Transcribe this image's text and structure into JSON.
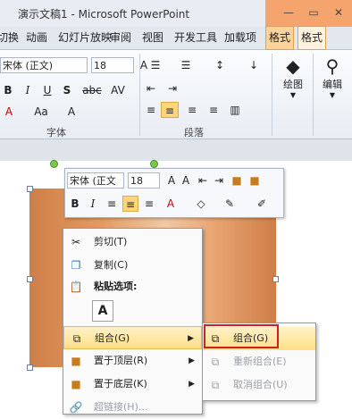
{
  "window": {
    "title": "演示文稿1 - Microsoft PowerPoint",
    "controls": [
      "—",
      "▭",
      "✕"
    ],
    "picture_tools_color": "#f4a46c"
  },
  "tabs": [
    "切换",
    "动画",
    "幻灯片放映",
    "审阅",
    "视图",
    "开发工具",
    "加载项",
    "格式",
    "格式"
  ],
  "ribbon": {
    "font_name": "宋体 (正文)",
    "font_size": "18",
    "font_group_label": "字体",
    "paragraph_group_label": "段落",
    "drawing_label": "绘图",
    "editing_label": "编辑",
    "bold": "B",
    "italic": "I",
    "underline": "U",
    "shadow": "S",
    "strike": "abc",
    "spacing": "AV",
    "font_color": "A",
    "case": "Aa",
    "clear": "A",
    "grow": "A",
    "shrink": "A"
  },
  "mini_toolbar": {
    "font_name": "宋体 (正文",
    "font_size": "18",
    "bold": "B",
    "italic": "I"
  },
  "context_menu": {
    "items": [
      {
        "label": "剪切(T)",
        "icon": "scissors-icon"
      },
      {
        "label": "复制(C)",
        "icon": "copy-icon"
      },
      {
        "label": "粘贴选项:",
        "icon": "paste-icon"
      },
      {
        "label": "组合(G)",
        "icon": "group-icon"
      },
      {
        "label": "置于顶层(R)",
        "icon": "bring-front-icon"
      },
      {
        "label": "置于底层(K)",
        "icon": "send-back-icon"
      },
      {
        "label": "超链接(H)...",
        "icon": "link-icon"
      }
    ],
    "paste_option": "A"
  },
  "submenu": {
    "items": [
      {
        "label": "组合(G)",
        "enabled": true
      },
      {
        "label": "重新组合(E)",
        "enabled": false
      },
      {
        "label": "取消组合(U)",
        "enabled": false
      }
    ]
  }
}
